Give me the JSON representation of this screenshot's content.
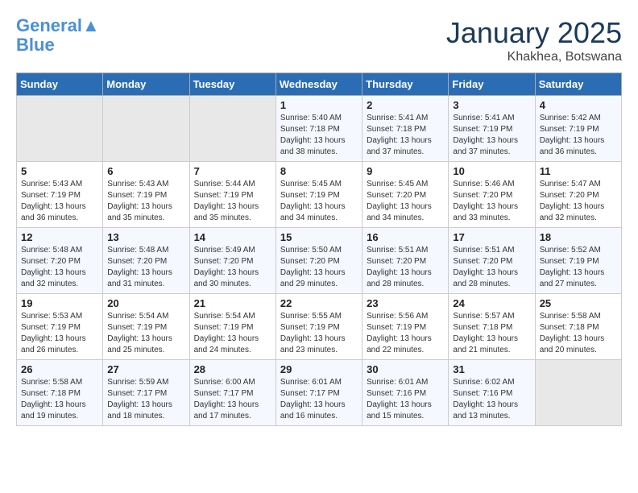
{
  "header": {
    "logo_line1": "General",
    "logo_line2": "Blue",
    "month": "January 2025",
    "location": "Khakhea, Botswana"
  },
  "weekdays": [
    "Sunday",
    "Monday",
    "Tuesday",
    "Wednesday",
    "Thursday",
    "Friday",
    "Saturday"
  ],
  "weeks": [
    [
      {
        "day": "",
        "info": ""
      },
      {
        "day": "",
        "info": ""
      },
      {
        "day": "",
        "info": ""
      },
      {
        "day": "1",
        "info": "Sunrise: 5:40 AM\nSunset: 7:18 PM\nDaylight: 13 hours\nand 38 minutes."
      },
      {
        "day": "2",
        "info": "Sunrise: 5:41 AM\nSunset: 7:18 PM\nDaylight: 13 hours\nand 37 minutes."
      },
      {
        "day": "3",
        "info": "Sunrise: 5:41 AM\nSunset: 7:19 PM\nDaylight: 13 hours\nand 37 minutes."
      },
      {
        "day": "4",
        "info": "Sunrise: 5:42 AM\nSunset: 7:19 PM\nDaylight: 13 hours\nand 36 minutes."
      }
    ],
    [
      {
        "day": "5",
        "info": "Sunrise: 5:43 AM\nSunset: 7:19 PM\nDaylight: 13 hours\nand 36 minutes."
      },
      {
        "day": "6",
        "info": "Sunrise: 5:43 AM\nSunset: 7:19 PM\nDaylight: 13 hours\nand 35 minutes."
      },
      {
        "day": "7",
        "info": "Sunrise: 5:44 AM\nSunset: 7:19 PM\nDaylight: 13 hours\nand 35 minutes."
      },
      {
        "day": "8",
        "info": "Sunrise: 5:45 AM\nSunset: 7:19 PM\nDaylight: 13 hours\nand 34 minutes."
      },
      {
        "day": "9",
        "info": "Sunrise: 5:45 AM\nSunset: 7:20 PM\nDaylight: 13 hours\nand 34 minutes."
      },
      {
        "day": "10",
        "info": "Sunrise: 5:46 AM\nSunset: 7:20 PM\nDaylight: 13 hours\nand 33 minutes."
      },
      {
        "day": "11",
        "info": "Sunrise: 5:47 AM\nSunset: 7:20 PM\nDaylight: 13 hours\nand 32 minutes."
      }
    ],
    [
      {
        "day": "12",
        "info": "Sunrise: 5:48 AM\nSunset: 7:20 PM\nDaylight: 13 hours\nand 32 minutes."
      },
      {
        "day": "13",
        "info": "Sunrise: 5:48 AM\nSunset: 7:20 PM\nDaylight: 13 hours\nand 31 minutes."
      },
      {
        "day": "14",
        "info": "Sunrise: 5:49 AM\nSunset: 7:20 PM\nDaylight: 13 hours\nand 30 minutes."
      },
      {
        "day": "15",
        "info": "Sunrise: 5:50 AM\nSunset: 7:20 PM\nDaylight: 13 hours\nand 29 minutes."
      },
      {
        "day": "16",
        "info": "Sunrise: 5:51 AM\nSunset: 7:20 PM\nDaylight: 13 hours\nand 28 minutes."
      },
      {
        "day": "17",
        "info": "Sunrise: 5:51 AM\nSunset: 7:20 PM\nDaylight: 13 hours\nand 28 minutes."
      },
      {
        "day": "18",
        "info": "Sunrise: 5:52 AM\nSunset: 7:19 PM\nDaylight: 13 hours\nand 27 minutes."
      }
    ],
    [
      {
        "day": "19",
        "info": "Sunrise: 5:53 AM\nSunset: 7:19 PM\nDaylight: 13 hours\nand 26 minutes."
      },
      {
        "day": "20",
        "info": "Sunrise: 5:54 AM\nSunset: 7:19 PM\nDaylight: 13 hours\nand 25 minutes."
      },
      {
        "day": "21",
        "info": "Sunrise: 5:54 AM\nSunset: 7:19 PM\nDaylight: 13 hours\nand 24 minutes."
      },
      {
        "day": "22",
        "info": "Sunrise: 5:55 AM\nSunset: 7:19 PM\nDaylight: 13 hours\nand 23 minutes."
      },
      {
        "day": "23",
        "info": "Sunrise: 5:56 AM\nSunset: 7:19 PM\nDaylight: 13 hours\nand 22 minutes."
      },
      {
        "day": "24",
        "info": "Sunrise: 5:57 AM\nSunset: 7:18 PM\nDaylight: 13 hours\nand 21 minutes."
      },
      {
        "day": "25",
        "info": "Sunrise: 5:58 AM\nSunset: 7:18 PM\nDaylight: 13 hours\nand 20 minutes."
      }
    ],
    [
      {
        "day": "26",
        "info": "Sunrise: 5:58 AM\nSunset: 7:18 PM\nDaylight: 13 hours\nand 19 minutes."
      },
      {
        "day": "27",
        "info": "Sunrise: 5:59 AM\nSunset: 7:17 PM\nDaylight: 13 hours\nand 18 minutes."
      },
      {
        "day": "28",
        "info": "Sunrise: 6:00 AM\nSunset: 7:17 PM\nDaylight: 13 hours\nand 17 minutes."
      },
      {
        "day": "29",
        "info": "Sunrise: 6:01 AM\nSunset: 7:17 PM\nDaylight: 13 hours\nand 16 minutes."
      },
      {
        "day": "30",
        "info": "Sunrise: 6:01 AM\nSunset: 7:16 PM\nDaylight: 13 hours\nand 15 minutes."
      },
      {
        "day": "31",
        "info": "Sunrise: 6:02 AM\nSunset: 7:16 PM\nDaylight: 13 hours\nand 13 minutes."
      },
      {
        "day": "",
        "info": ""
      }
    ]
  ]
}
